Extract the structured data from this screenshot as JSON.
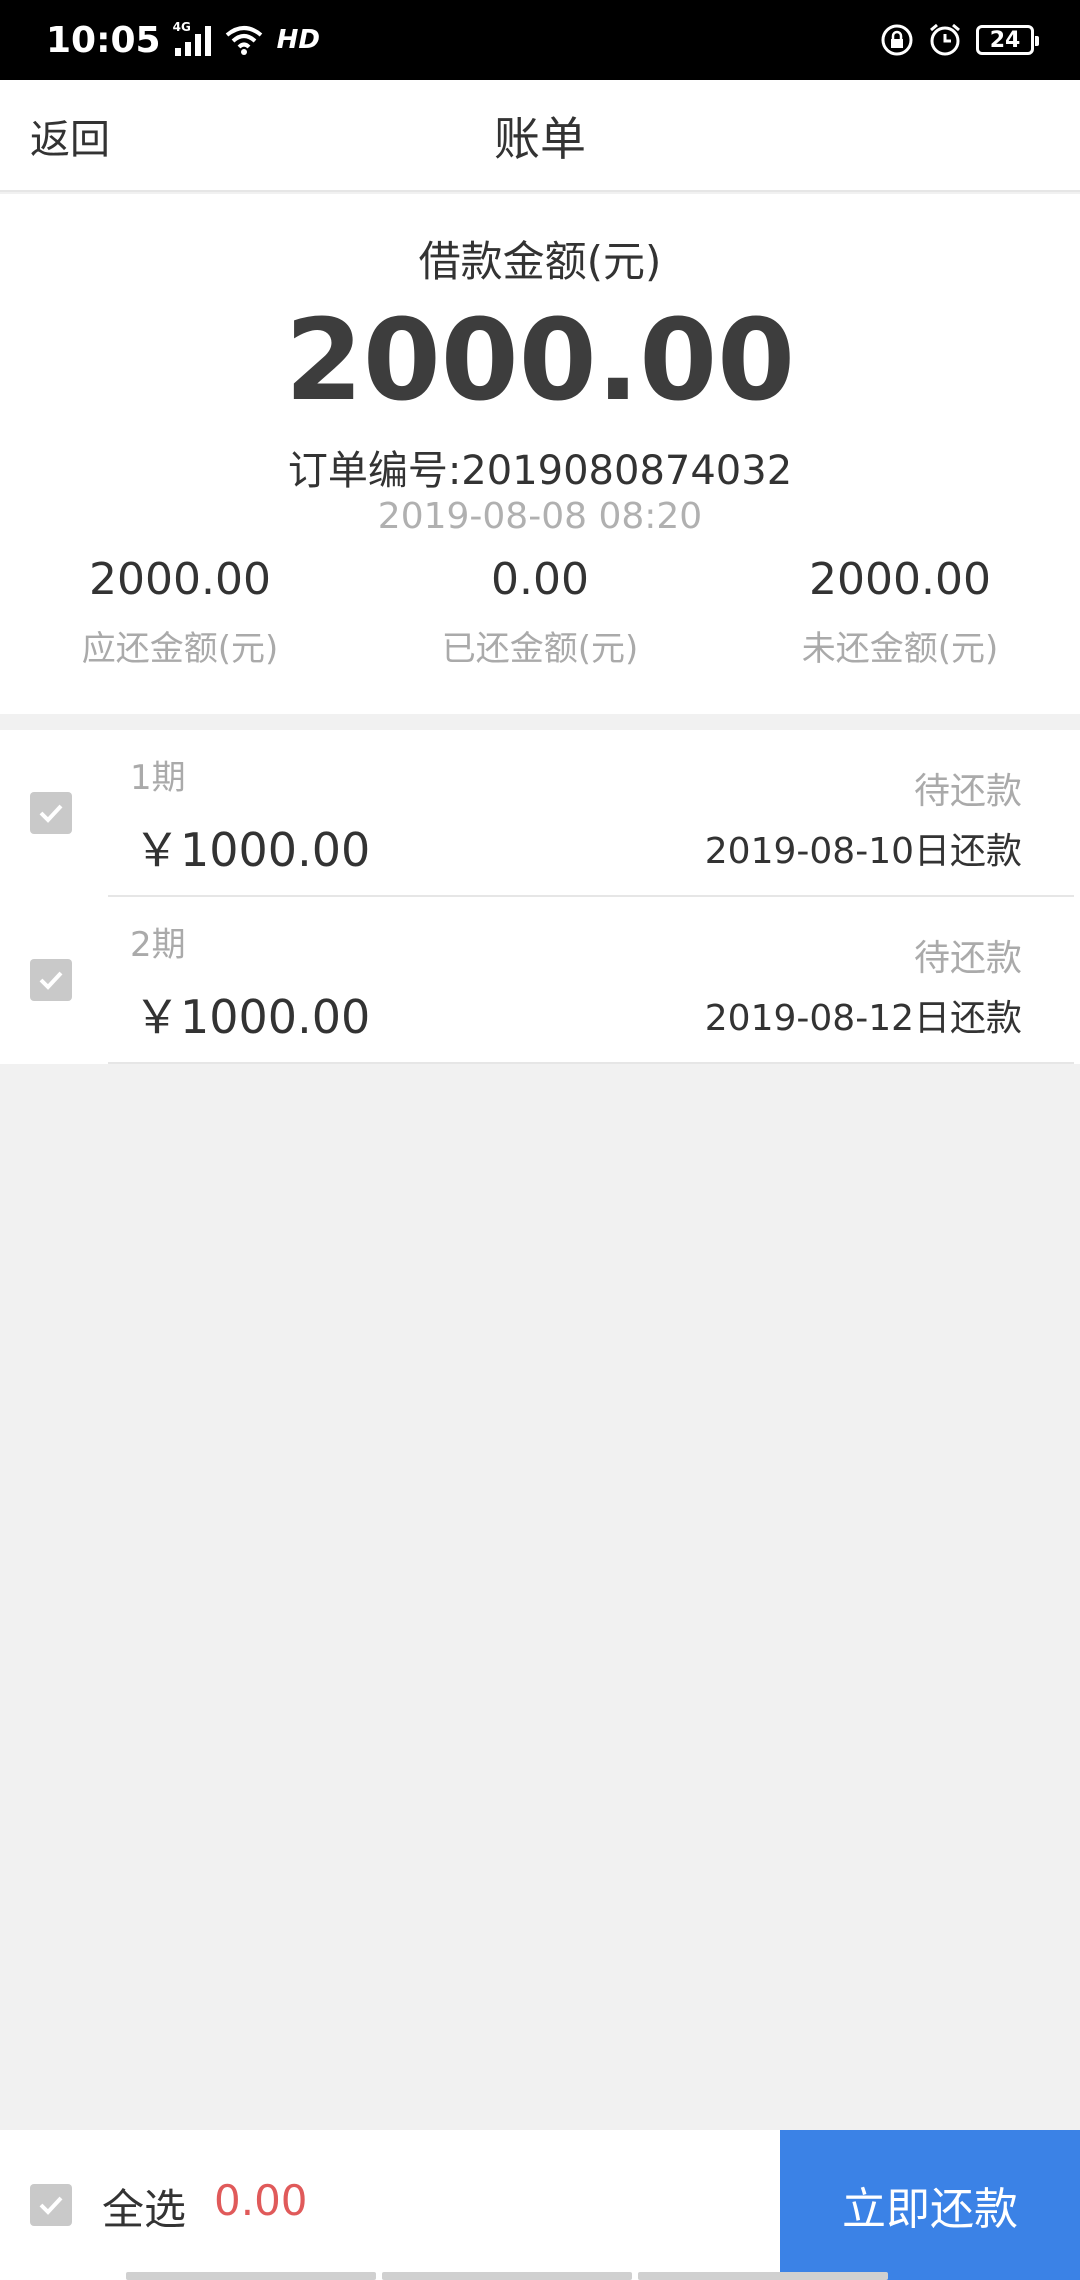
{
  "status_bar": {
    "time": "10:05",
    "network": "4G",
    "hd": "HD",
    "battery": "24"
  },
  "nav": {
    "back_label": "返回",
    "title": "账单"
  },
  "summary": {
    "loan_label": "借款金额(元)",
    "loan_amount": "2000.00",
    "order_number": "订单编号:2019080874032",
    "order_time": "2019-08-08 08:20",
    "stats": [
      {
        "value": "2000.00",
        "label": "应还金额(元)"
      },
      {
        "value": "0.00",
        "label": "已还金额(元)"
      },
      {
        "value": "2000.00",
        "label": "未还金额(元)"
      }
    ]
  },
  "installments": [
    {
      "period": "1期",
      "amount": "￥1000.00",
      "status": "待还款",
      "due": "2019-08-10日还款"
    },
    {
      "period": "2期",
      "amount": "￥1000.00",
      "status": "待还款",
      "due": "2019-08-12日还款"
    }
  ],
  "bottom": {
    "select_all_label": "全选",
    "total": "0.00",
    "pay_button_label": "立即还款"
  },
  "colors": {
    "accent": "#3b82e6",
    "total_text": "#e05a5a",
    "checkbox": "#c9c9c9"
  }
}
